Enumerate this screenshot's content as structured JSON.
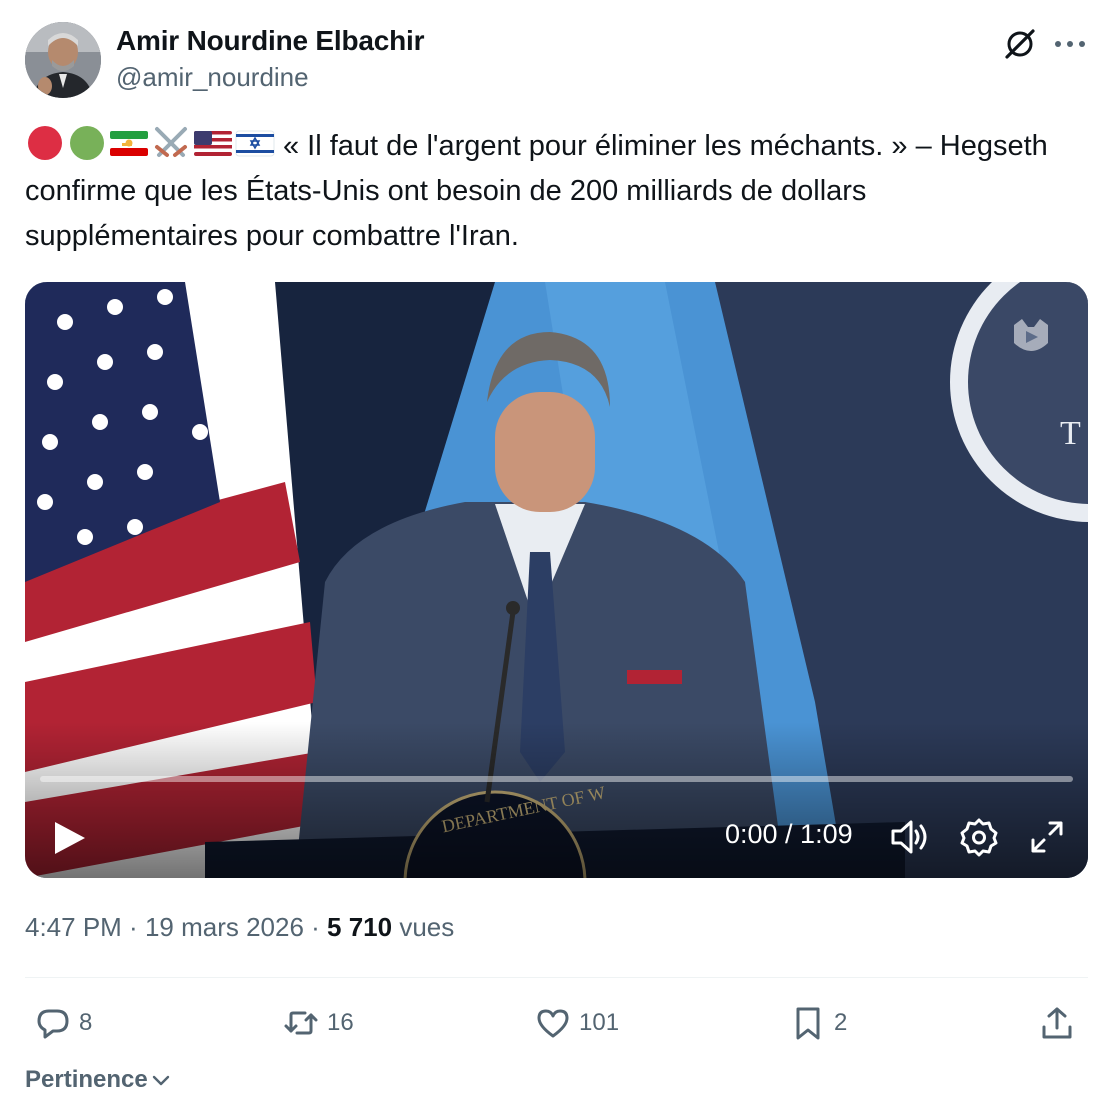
{
  "author": {
    "display_name": "Amir Nourdine Elbachir",
    "handle": "@amir_nourdine"
  },
  "header_icons": {
    "grok": "grok-slash-icon",
    "more": "more-dots-icon"
  },
  "tweet": {
    "emoji": [
      "red-circle",
      "green-circle",
      "iran-lion-sun-flag",
      "crossed-swords",
      "us-flag",
      "israel-flag"
    ],
    "text": "« Il faut de l'argent pour éliminer les méchants. » – Hegseth confirme que les États-Unis ont besoin de 200 milliards de dollars supplémentaires pour combattre l'Iran."
  },
  "video": {
    "timecode": "0:00 / 1:09",
    "progress": 0,
    "controls": [
      "play-icon",
      "volume-icon",
      "settings-gear-icon",
      "fullscreen-icon"
    ]
  },
  "meta": {
    "time": "4:47 PM",
    "separator": " · ",
    "date": "19 mars 2026",
    "views_count": "5 710",
    "views_label": "vues"
  },
  "actions": {
    "replies": "8",
    "reposts": "16",
    "likes": "101",
    "bookmarks": "2"
  },
  "sort": {
    "label": "Pertinence"
  },
  "colors": {
    "text_primary": "#0f1419",
    "text_secondary": "#536471",
    "accent": "#1d9bf0",
    "divider": "#eff3f4"
  }
}
